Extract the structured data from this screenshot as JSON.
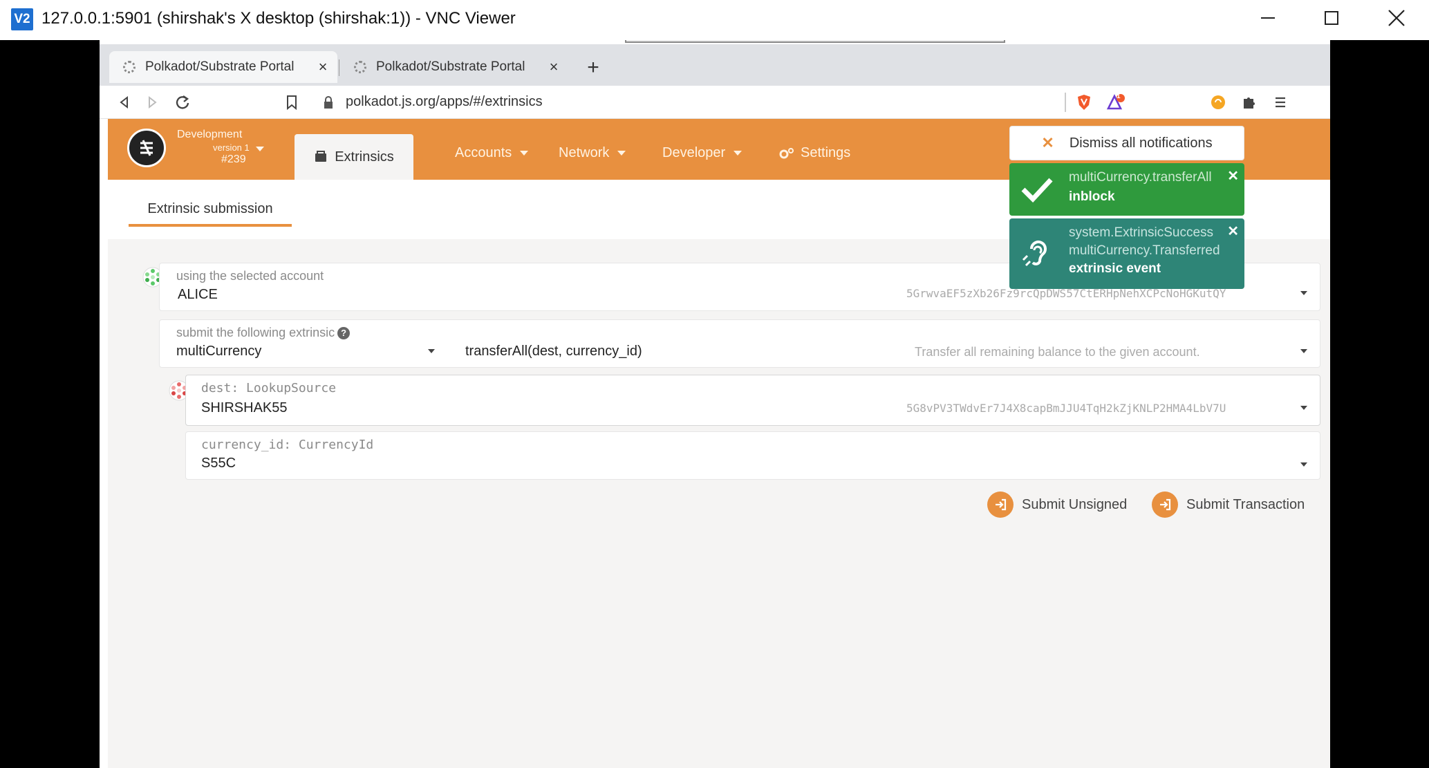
{
  "vnc": {
    "logo_text": "V2",
    "title": "127.0.0.1:5901 (shirshak's X desktop (shirshak:1)) - VNC Viewer"
  },
  "browser": {
    "tabs": [
      {
        "label": "Polkadot/Substrate Portal",
        "active": true
      },
      {
        "label": "Polkadot/Substrate Portal",
        "active": false
      }
    ],
    "new_tab": "+",
    "url": "polkadot.js.org/apps/#/extrinsics",
    "brave_badge": "1"
  },
  "app": {
    "chain": {
      "name": "Development",
      "version": "version 1",
      "block": "#239"
    },
    "nav": {
      "active": "Extrinsics",
      "items": [
        "Accounts",
        "Network",
        "Developer",
        "Settings"
      ]
    },
    "subtab": "Extrinsic submission",
    "account_field": {
      "label": "using the selected account",
      "value": "ALICE",
      "address": "5GrwvaEF5zXb26Fz9rcQpDWS57CtERHpNehXCPcNoHGKutQY"
    },
    "extrinsic_field": {
      "label": "submit the following extrinsic",
      "module": "multiCurrency",
      "method": "transferAll(dest, currency_id)",
      "description": "Transfer all remaining balance to the given account."
    },
    "dest_field": {
      "label": "dest: LookupSource",
      "value": "SHIRSHAK55",
      "address": "5G8vPV3TWdvEr7J4X8capBmJJU4TqH2kZjKNLP2HMA4LbV7U"
    },
    "currency_field": {
      "label": "currency_id: CurrencyId",
      "value": "S55C"
    },
    "buttons": {
      "unsigned": "Submit Unsigned",
      "transaction": "Submit Transaction"
    }
  },
  "notifications": {
    "dismiss_all": "Dismiss all notifications",
    "items": [
      {
        "lines": [
          "multiCurrency.transferAll"
        ],
        "status": "inblock",
        "color": "#2f9a3d"
      },
      {
        "lines": [
          "system.ExtrinsicSuccess",
          "multiCurrency.Transferred"
        ],
        "status": "extrinsic event",
        "color": "#2e8577"
      }
    ]
  },
  "colors": {
    "accent": "#e8903f",
    "success": "#2f9a3d",
    "event": "#2e8577"
  }
}
